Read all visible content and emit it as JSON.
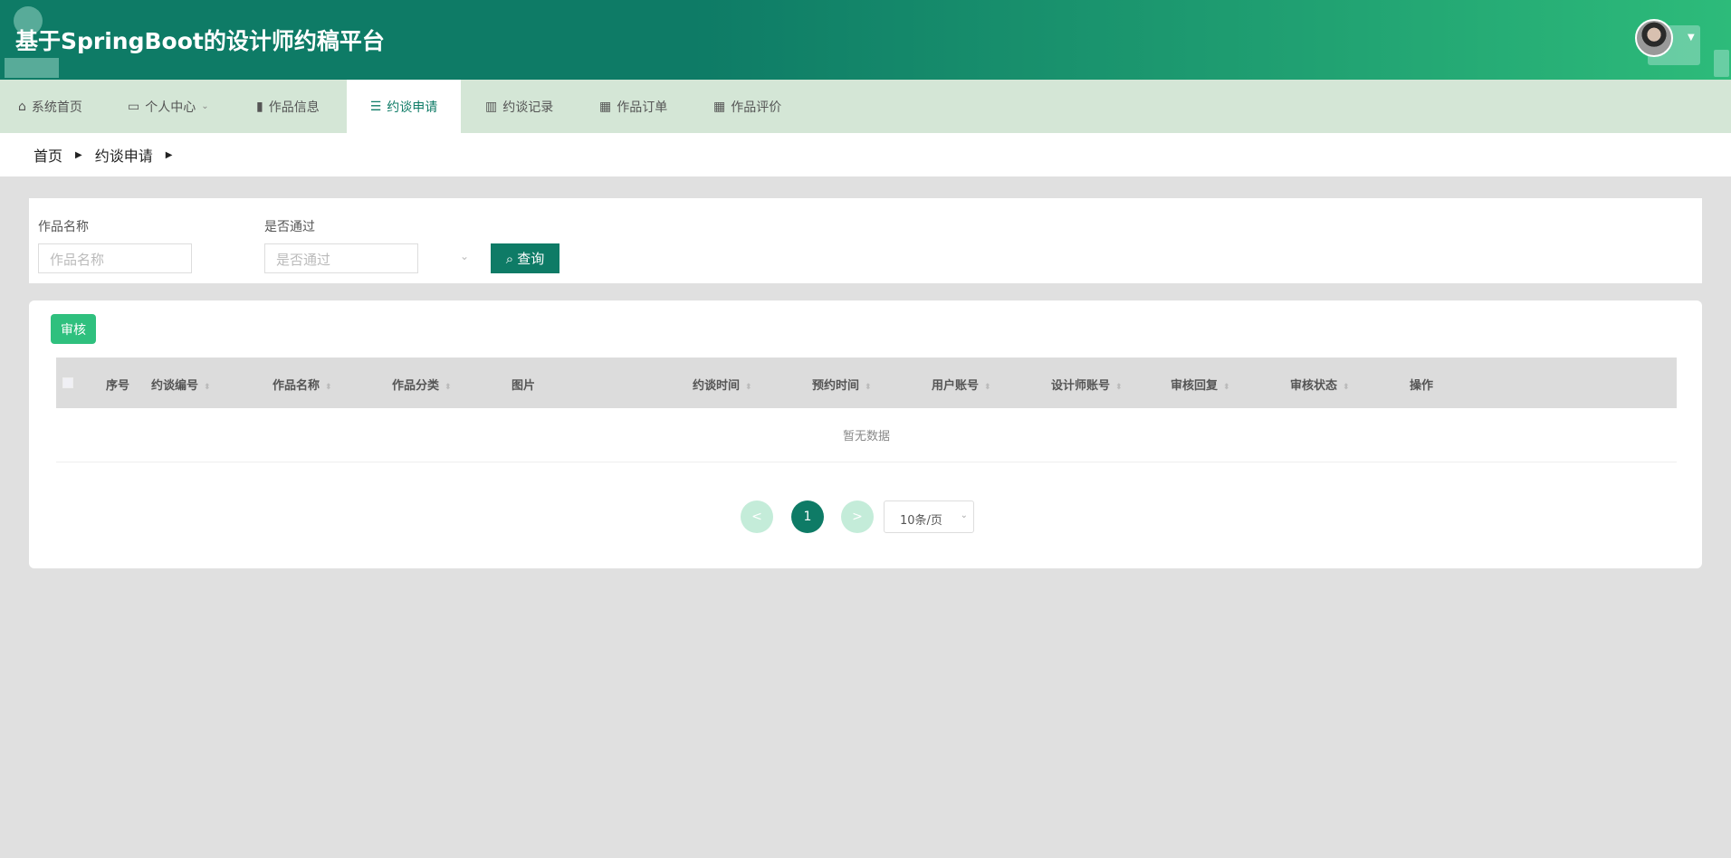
{
  "header": {
    "title": "基于SpringBoot的设计师约稿平台"
  },
  "nav": {
    "items": [
      {
        "label": "系统首页",
        "icon": "home-icon"
      },
      {
        "label": "个人中心",
        "icon": "wallet-icon"
      },
      {
        "label": "作品信息",
        "icon": "clipboard-icon"
      },
      {
        "label": "约谈申请",
        "icon": "list-icon",
        "active": true
      },
      {
        "label": "约谈记录",
        "icon": "book-icon"
      },
      {
        "label": "作品订单",
        "icon": "grid-icon"
      },
      {
        "label": "作品评价",
        "icon": "grid-icon"
      }
    ]
  },
  "breadcrumb": [
    "首页",
    "约谈申请"
  ],
  "search": {
    "name_label": "作品名称",
    "name_placeholder": "作品名称",
    "pass_label": "是否通过",
    "pass_placeholder": "是否通过",
    "query_label": "查询"
  },
  "toolbar": {
    "audit_label": "审核"
  },
  "table": {
    "columns": [
      "序号",
      "约谈编号",
      "作品名称",
      "作品分类",
      "图片",
      "约谈时间",
      "预约时间",
      "用户账号",
      "设计师账号",
      "审核回复",
      "审核状态",
      "操作"
    ],
    "empty_text": "暂无数据"
  },
  "pagination": {
    "prev": "<",
    "current": "1",
    "next": ">",
    "page_size": "10条/页"
  },
  "colors": {
    "primary": "#0e7b66",
    "accent": "#2fc07e"
  }
}
